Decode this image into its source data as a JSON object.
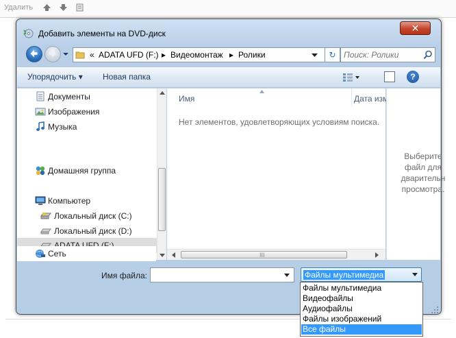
{
  "background_app": {
    "delete_label": "Удалить"
  },
  "dialog": {
    "title": "Добавить элементы на DVD-диск",
    "close_glyph": "✕"
  },
  "address_bar": {
    "overflow": "«",
    "segments": [
      "ADATA UFD (F:)",
      "▸",
      "Видеомонтаж",
      "▸",
      "Ролики"
    ],
    "refresh_glyph": "↻"
  },
  "search": {
    "placeholder": "Поиск: Ролики"
  },
  "command_bar": {
    "organize_label": "Упорядочить ▾",
    "new_folder_label": "Новая папка",
    "help_glyph": "?"
  },
  "nav_pane": {
    "items": [
      {
        "label": "Документы",
        "icon": "documents-icon"
      },
      {
        "label": "Изображения",
        "icon": "pictures-icon"
      },
      {
        "label": "Музыка",
        "icon": "music-icon"
      },
      {
        "label": "Домашняя группа",
        "icon": "homegroup-icon"
      },
      {
        "label": "Компьютер",
        "icon": "computer-icon"
      },
      {
        "label": "Локальный диск (C:)",
        "icon": "drive-c-icon"
      },
      {
        "label": "Локальный диск (D:)",
        "icon": "drive-d-icon"
      },
      {
        "label": "ADATA UFD (F:)",
        "icon": "usb-drive-icon",
        "selected": true
      },
      {
        "label": "Сеть",
        "icon": "network-icon"
      }
    ]
  },
  "file_list": {
    "column_name": "Имя",
    "column_date": "Дата изм",
    "empty_message": "Нет элементов, удовлетворяющих условиям поиска.",
    "hscroll_grip": "III"
  },
  "preview_pane": {
    "text": "Выберите\nфайл для\nдварительн\nпросмотра."
  },
  "file_name": {
    "label": "Имя файла:",
    "value": ""
  },
  "file_type": {
    "selected": "Файлы мультимедиа",
    "options": [
      "Файлы мультимедиа",
      "Видеофайлы",
      "Аудиофайлы",
      "Файлы изображений",
      "Все файлы"
    ],
    "highlighted_option": "Все файлы"
  }
}
